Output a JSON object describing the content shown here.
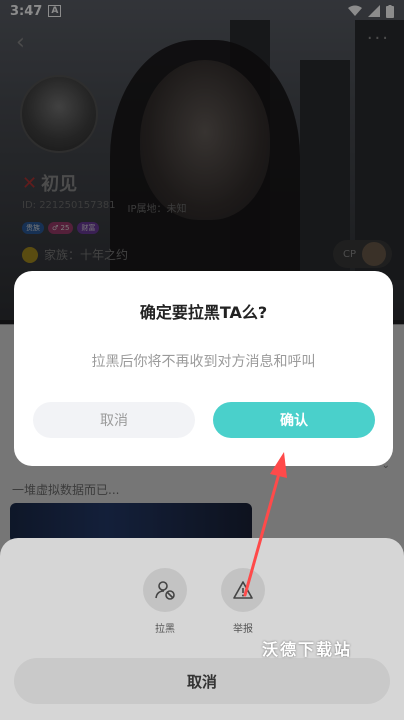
{
  "status_bar": {
    "time": "3:47",
    "notification": "A"
  },
  "profile": {
    "nickname": "初见",
    "id_text": "ID: 221250157381",
    "ip_text": "IP属地：未知",
    "badges": [
      "贵族",
      "♂ 25",
      "财富"
    ],
    "family_text": "家族：十年之约",
    "cp_label": "CP",
    "bio": "一堆虚拟数据而已..."
  },
  "dialog": {
    "title": "确定要拉黑TA么?",
    "message": "拉黑后你将不再收到对方消息和呼叫",
    "cancel_label": "取消",
    "confirm_label": "确认"
  },
  "sheet": {
    "actions": [
      {
        "label": "拉黑",
        "icon": "block-user-icon"
      },
      {
        "label": "举报",
        "icon": "warning-icon"
      }
    ],
    "cancel_label": "取消"
  },
  "watermark": "沃德下载站",
  "colors": {
    "confirm": "#4ad0cb",
    "annotation_arrow": "#ff4a4a"
  }
}
